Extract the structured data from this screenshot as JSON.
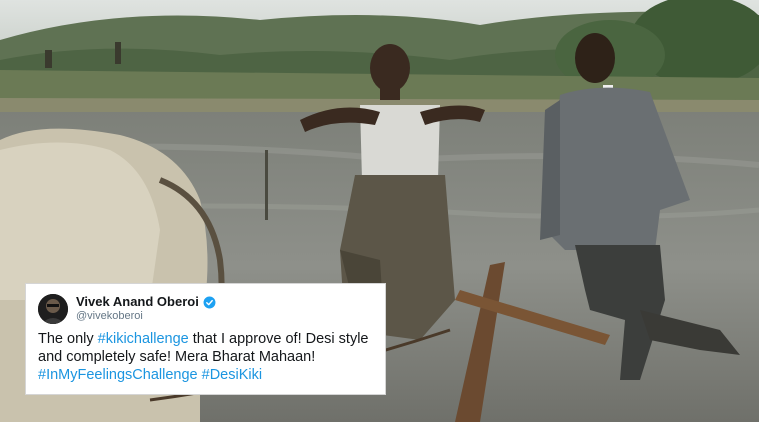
{
  "tweet": {
    "author_name": "Vivek Anand Oberoi",
    "author_handle": "@vivekoberoi",
    "text_parts": [
      {
        "text": "The only ",
        "tag": false
      },
      {
        "text": "#kikichallenge",
        "tag": true
      },
      {
        "text": " that I approve of! Desi style and completely safe! Mera Bharat Mahaan! ",
        "tag": false
      },
      {
        "text": "#InMyFeelingsChallenge",
        "tag": true
      },
      {
        "text": " ",
        "tag": false
      },
      {
        "text": "#DesiKiki",
        "tag": true
      }
    ],
    "verified_icon": "verified-badge-icon",
    "hashtag_color": "#1b95e0"
  }
}
